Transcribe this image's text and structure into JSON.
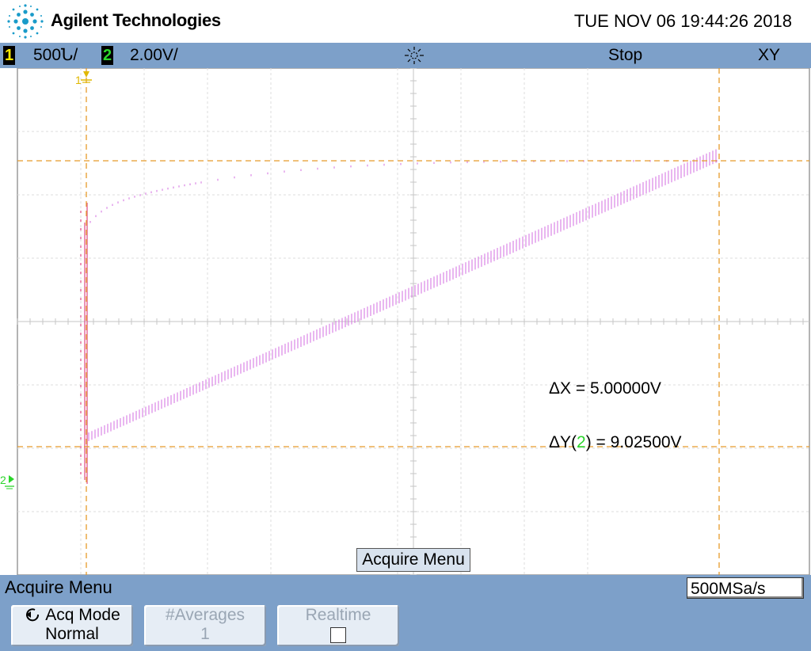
{
  "header": {
    "brand": "Agilent Technologies",
    "datetime": "TUE NOV 06 19:44:26 2018"
  },
  "status": {
    "ch1_label": "1",
    "ch1_scale": "500Ն/",
    "ch2_label": "2",
    "ch2_scale": "2.00V/",
    "run_state": "Stop",
    "mode": "XY"
  },
  "markers": {
    "ch1_marker": "1",
    "ch2_marker": "2"
  },
  "measurements": {
    "dx": "ΔX = 5.00000V",
    "dy_prefix": "ΔY(",
    "dy_channel": "2",
    "dy_suffix": ") = 9.02500V"
  },
  "popup": {
    "label": "Acquire Menu"
  },
  "menu": {
    "title": "Acquire Menu",
    "sample_rate": "500MSa/s",
    "softkeys": [
      {
        "line1": "Acq Mode",
        "line2": "Normal"
      },
      {
        "line1": "#Averages",
        "line2": "1"
      },
      {
        "line1": "Realtime",
        "line2": ""
      }
    ]
  },
  "colors": {
    "trace": "#d36ee0",
    "cursor": "#e69a2a",
    "ch1": "#ffeb00",
    "ch2": "#2bd62b",
    "bar": "#7da0c9"
  }
}
